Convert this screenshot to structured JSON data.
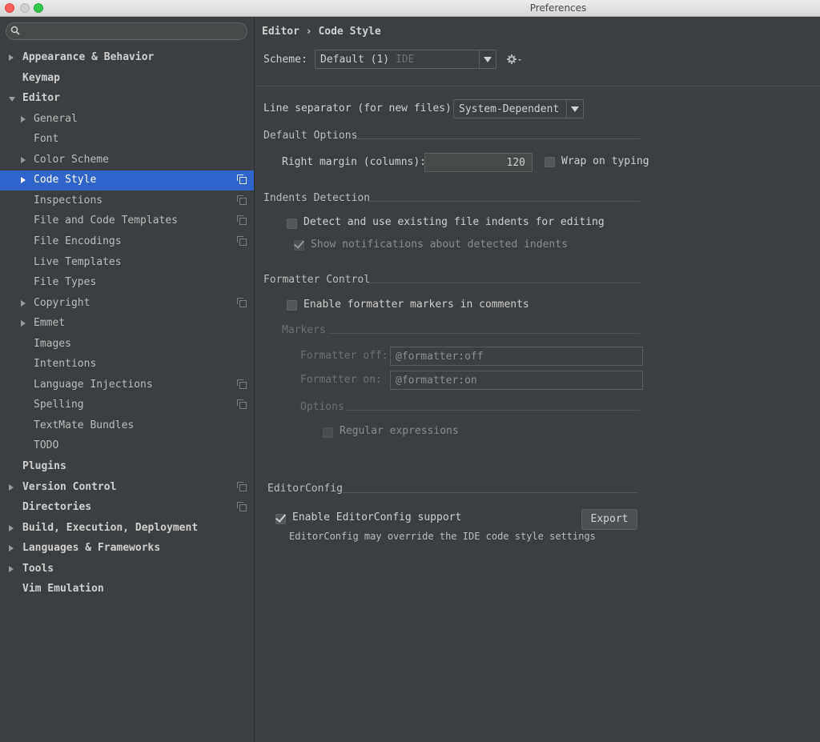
{
  "window": {
    "title": "Preferences"
  },
  "sidebar": {
    "search_placeholder": "",
    "items": [
      {
        "label": "Appearance & Behavior",
        "level": 0,
        "arrow": "right",
        "copy": false
      },
      {
        "label": "Keymap",
        "level": 0,
        "arrow": "none",
        "copy": false
      },
      {
        "label": "Editor",
        "level": 0,
        "arrow": "down",
        "copy": false
      },
      {
        "label": "General",
        "level": 1,
        "arrow": "right",
        "copy": false
      },
      {
        "label": "Font",
        "level": 1,
        "arrow": "none",
        "copy": false
      },
      {
        "label": "Color Scheme",
        "level": 1,
        "arrow": "right",
        "copy": false
      },
      {
        "label": "Code Style",
        "level": 1,
        "arrow": "right",
        "copy": true,
        "selected": true
      },
      {
        "label": "Inspections",
        "level": 1,
        "arrow": "none",
        "copy": true
      },
      {
        "label": "File and Code Templates",
        "level": 1,
        "arrow": "none",
        "copy": true
      },
      {
        "label": "File Encodings",
        "level": 1,
        "arrow": "none",
        "copy": true
      },
      {
        "label": "Live Templates",
        "level": 1,
        "arrow": "none",
        "copy": false
      },
      {
        "label": "File Types",
        "level": 1,
        "arrow": "none",
        "copy": false
      },
      {
        "label": "Copyright",
        "level": 1,
        "arrow": "right",
        "copy": true
      },
      {
        "label": "Emmet",
        "level": 1,
        "arrow": "right",
        "copy": false
      },
      {
        "label": "Images",
        "level": 1,
        "arrow": "none",
        "copy": false
      },
      {
        "label": "Intentions",
        "level": 1,
        "arrow": "none",
        "copy": false
      },
      {
        "label": "Language Injections",
        "level": 1,
        "arrow": "none",
        "copy": true
      },
      {
        "label": "Spelling",
        "level": 1,
        "arrow": "none",
        "copy": true
      },
      {
        "label": "TextMate Bundles",
        "level": 1,
        "arrow": "none",
        "copy": false
      },
      {
        "label": "TODO",
        "level": 1,
        "arrow": "none",
        "copy": false
      },
      {
        "label": "Plugins",
        "level": 0,
        "arrow": "none",
        "copy": false
      },
      {
        "label": "Version Control",
        "level": 0,
        "arrow": "right",
        "copy": true
      },
      {
        "label": "Directories",
        "level": 0,
        "arrow": "none",
        "copy": true
      },
      {
        "label": "Build, Execution, Deployment",
        "level": 0,
        "arrow": "right",
        "copy": false
      },
      {
        "label": "Languages & Frameworks",
        "level": 0,
        "arrow": "right",
        "copy": false
      },
      {
        "label": "Tools",
        "level": 0,
        "arrow": "right",
        "copy": false
      },
      {
        "label": "Vim Emulation",
        "level": 0,
        "arrow": "none",
        "copy": false
      }
    ]
  },
  "main": {
    "breadcrumb": "Editor › Code Style",
    "scheme_label": "Scheme:",
    "scheme_value": "Default (1)",
    "scheme_scope": "IDE",
    "line_sep_label": "Line separator (for new files):",
    "line_sep_value": "System-Dependent",
    "default_options_title": "Default Options",
    "right_margin_label": "Right margin (columns):",
    "right_margin_value": "120",
    "wrap_on_typing_label": "Wrap on typing",
    "indents_title": "Indents Detection",
    "detect_indents_label": "Detect and use existing file indents for editing",
    "show_notifications_label": "Show notifications about detected indents",
    "formatter_title": "Formatter Control",
    "enable_markers_label": "Enable formatter markers in comments",
    "markers_title": "Markers",
    "formatter_off_label": "Formatter off:",
    "formatter_off_value": "@formatter:off",
    "formatter_on_label": "Formatter on:",
    "formatter_on_value": "@formatter:on",
    "options_title": "Options",
    "regex_label": "Regular expressions",
    "editorconfig_title": "EditorConfig",
    "enable_editorconfig_label": "Enable EditorConfig support",
    "editorconfig_note": "EditorConfig may override the IDE code style settings",
    "export_label": "Export"
  }
}
